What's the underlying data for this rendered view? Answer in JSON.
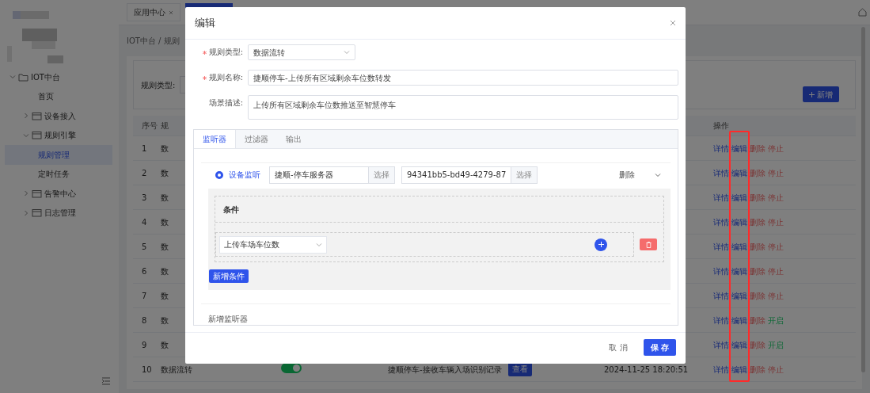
{
  "sidebar": {
    "items": [
      {
        "kind": "group",
        "label": "IOT中台",
        "expanded": true,
        "children": [
          {
            "kind": "page",
            "label": "首页",
            "selected": false
          },
          {
            "kind": "group",
            "label": "设备接入",
            "expanded": false
          },
          {
            "kind": "group",
            "label": "规则引擎",
            "expanded": true,
            "children": [
              {
                "kind": "page",
                "label": "规则管理",
                "selected": true
              },
              {
                "kind": "page",
                "label": "定时任务",
                "selected": false
              }
            ]
          },
          {
            "kind": "group",
            "label": "告警中心",
            "expanded": false
          },
          {
            "kind": "group",
            "label": "日志管理",
            "expanded": false
          }
        ]
      }
    ]
  },
  "tabs": [
    {
      "label": "应用中心",
      "selected": false
    },
    {
      "selected": true
    }
  ],
  "breadcrumb": "IOT中台 / 规则",
  "filter": {
    "label": "规则类型:"
  },
  "add_button": "新增",
  "table": {
    "columns": [
      {
        "label": "序号"
      },
      {
        "label": "规"
      },
      {
        "label": "操作"
      }
    ],
    "rows": [
      {
        "index": "1",
        "type": "数",
        "actions": [
          {
            "label": "详情",
            "kind": "detail"
          },
          {
            "label": "编辑",
            "kind": "edit"
          },
          {
            "label": "删除",
            "kind": "delete"
          },
          {
            "label": "停止",
            "kind": "stop"
          }
        ]
      },
      {
        "index": "2",
        "type": "数",
        "actions": [
          {
            "label": "详情",
            "kind": "detail"
          },
          {
            "label": "编辑",
            "kind": "edit"
          },
          {
            "label": "删除",
            "kind": "delete"
          },
          {
            "label": "停止",
            "kind": "stop"
          }
        ]
      },
      {
        "index": "3",
        "type": "数",
        "actions": [
          {
            "label": "详情",
            "kind": "detail"
          },
          {
            "label": "编辑",
            "kind": "edit"
          },
          {
            "label": "删除",
            "kind": "delete"
          },
          {
            "label": "停止",
            "kind": "stop"
          }
        ]
      },
      {
        "index": "4",
        "type": "数",
        "actions": [
          {
            "label": "详情",
            "kind": "detail"
          },
          {
            "label": "编辑",
            "kind": "edit"
          },
          {
            "label": "删除",
            "kind": "delete"
          },
          {
            "label": "停止",
            "kind": "stop"
          }
        ]
      },
      {
        "index": "5",
        "type": "数",
        "actions": [
          {
            "label": "详情",
            "kind": "detail"
          },
          {
            "label": "编辑",
            "kind": "edit"
          },
          {
            "label": "删除",
            "kind": "delete"
          },
          {
            "label": "停止",
            "kind": "stop"
          }
        ]
      },
      {
        "index": "6",
        "type": "数",
        "actions": [
          {
            "label": "详情",
            "kind": "detail"
          },
          {
            "label": "编辑",
            "kind": "edit"
          },
          {
            "label": "删除",
            "kind": "delete"
          },
          {
            "label": "停止",
            "kind": "stop"
          }
        ]
      },
      {
        "index": "7",
        "type": "数",
        "actions": [
          {
            "label": "详情",
            "kind": "detail"
          },
          {
            "label": "编辑",
            "kind": "edit"
          },
          {
            "label": "删除",
            "kind": "delete"
          },
          {
            "label": "停止",
            "kind": "stop"
          }
        ]
      },
      {
        "index": "8",
        "type": "数",
        "actions": [
          {
            "label": "详情",
            "kind": "detail"
          },
          {
            "label": "编辑",
            "kind": "edit"
          },
          {
            "label": "删除",
            "kind": "delete"
          },
          {
            "label": "开启",
            "kind": "start"
          }
        ]
      },
      {
        "index": "9",
        "type": "数",
        "actions": [
          {
            "label": "详情",
            "kind": "detail"
          },
          {
            "label": "编辑",
            "kind": "edit"
          },
          {
            "label": "删除",
            "kind": "delete"
          },
          {
            "label": "开启",
            "kind": "start"
          }
        ]
      },
      {
        "index": "10",
        "type": "数据流转",
        "enabled": true,
        "name": "捷顺停车-接收车辆入场识别记录",
        "view": "查看",
        "time": "2024-11-25 18:20:51",
        "actions": [
          {
            "label": "详情",
            "kind": "detail"
          },
          {
            "label": "编辑",
            "kind": "edit"
          },
          {
            "label": "删除",
            "kind": "delete"
          },
          {
            "label": "停止",
            "kind": "stop"
          }
        ]
      }
    ]
  },
  "dialog": {
    "title": "编辑",
    "fields": [
      {
        "label": "规则类型:",
        "required": true,
        "kind": "select",
        "value": "数据流转"
      },
      {
        "label": "规则名称:",
        "required": true,
        "kind": "input",
        "value": "捷顺停车-上传所有区域剩余车位数转发"
      },
      {
        "label": "场景描述:",
        "required": false,
        "kind": "textarea",
        "value": "上传所有区域剩余车位数推送至智慧停车"
      }
    ],
    "tabs": [
      {
        "label": "监听器",
        "selected": true
      },
      {
        "label": "过滤器",
        "selected": false
      },
      {
        "label": "输出",
        "selected": false
      }
    ],
    "listener": {
      "option": "设备监听",
      "checked": true,
      "device_name": "捷顺-停车服务器",
      "device_button": "选择",
      "device_id": "94341bb5-bd49-4279-87",
      "id_button": "选择",
      "delete": "删除",
      "expanded": true
    },
    "conditions": {
      "title": "条件",
      "items": [
        {
          "value": "上传车场车位数"
        }
      ],
      "add_button": "新增条件"
    },
    "add_listener": "新增监听器",
    "buttons": [
      {
        "label": "取 消",
        "kind": "text"
      },
      {
        "label": "保 存",
        "kind": "primary"
      }
    ]
  }
}
